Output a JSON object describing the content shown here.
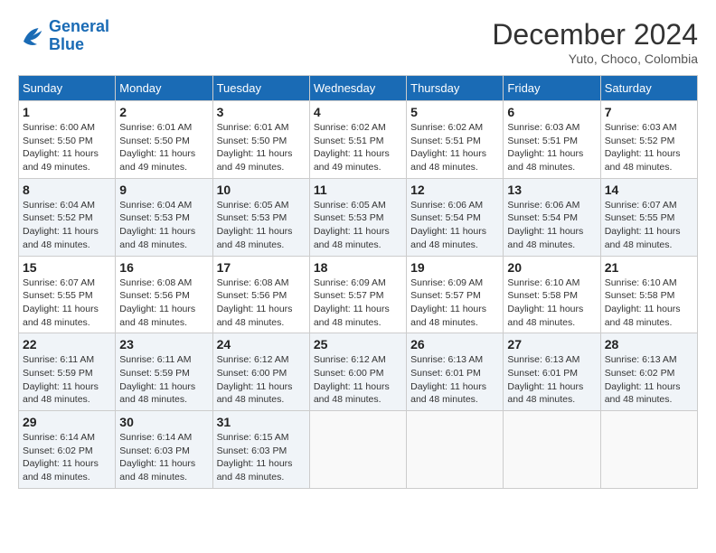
{
  "header": {
    "logo_general": "General",
    "logo_blue": "Blue",
    "month_title": "December 2024",
    "location": "Yuto, Choco, Colombia"
  },
  "columns": [
    "Sunday",
    "Monday",
    "Tuesday",
    "Wednesday",
    "Thursday",
    "Friday",
    "Saturday"
  ],
  "weeks": [
    [
      {
        "day": "1",
        "sunrise": "6:00 AM",
        "sunset": "5:50 PM",
        "daylight": "11 hours and 49 minutes."
      },
      {
        "day": "2",
        "sunrise": "6:01 AM",
        "sunset": "5:50 PM",
        "daylight": "11 hours and 49 minutes."
      },
      {
        "day": "3",
        "sunrise": "6:01 AM",
        "sunset": "5:50 PM",
        "daylight": "11 hours and 49 minutes."
      },
      {
        "day": "4",
        "sunrise": "6:02 AM",
        "sunset": "5:51 PM",
        "daylight": "11 hours and 49 minutes."
      },
      {
        "day": "5",
        "sunrise": "6:02 AM",
        "sunset": "5:51 PM",
        "daylight": "11 hours and 48 minutes."
      },
      {
        "day": "6",
        "sunrise": "6:03 AM",
        "sunset": "5:51 PM",
        "daylight": "11 hours and 48 minutes."
      },
      {
        "day": "7",
        "sunrise": "6:03 AM",
        "sunset": "5:52 PM",
        "daylight": "11 hours and 48 minutes."
      }
    ],
    [
      {
        "day": "8",
        "sunrise": "6:04 AM",
        "sunset": "5:52 PM",
        "daylight": "11 hours and 48 minutes."
      },
      {
        "day": "9",
        "sunrise": "6:04 AM",
        "sunset": "5:53 PM",
        "daylight": "11 hours and 48 minutes."
      },
      {
        "day": "10",
        "sunrise": "6:05 AM",
        "sunset": "5:53 PM",
        "daylight": "11 hours and 48 minutes."
      },
      {
        "day": "11",
        "sunrise": "6:05 AM",
        "sunset": "5:53 PM",
        "daylight": "11 hours and 48 minutes."
      },
      {
        "day": "12",
        "sunrise": "6:06 AM",
        "sunset": "5:54 PM",
        "daylight": "11 hours and 48 minutes."
      },
      {
        "day": "13",
        "sunrise": "6:06 AM",
        "sunset": "5:54 PM",
        "daylight": "11 hours and 48 minutes."
      },
      {
        "day": "14",
        "sunrise": "6:07 AM",
        "sunset": "5:55 PM",
        "daylight": "11 hours and 48 minutes."
      }
    ],
    [
      {
        "day": "15",
        "sunrise": "6:07 AM",
        "sunset": "5:55 PM",
        "daylight": "11 hours and 48 minutes."
      },
      {
        "day": "16",
        "sunrise": "6:08 AM",
        "sunset": "5:56 PM",
        "daylight": "11 hours and 48 minutes."
      },
      {
        "day": "17",
        "sunrise": "6:08 AM",
        "sunset": "5:56 PM",
        "daylight": "11 hours and 48 minutes."
      },
      {
        "day": "18",
        "sunrise": "6:09 AM",
        "sunset": "5:57 PM",
        "daylight": "11 hours and 48 minutes."
      },
      {
        "day": "19",
        "sunrise": "6:09 AM",
        "sunset": "5:57 PM",
        "daylight": "11 hours and 48 minutes."
      },
      {
        "day": "20",
        "sunrise": "6:10 AM",
        "sunset": "5:58 PM",
        "daylight": "11 hours and 48 minutes."
      },
      {
        "day": "21",
        "sunrise": "6:10 AM",
        "sunset": "5:58 PM",
        "daylight": "11 hours and 48 minutes."
      }
    ],
    [
      {
        "day": "22",
        "sunrise": "6:11 AM",
        "sunset": "5:59 PM",
        "daylight": "11 hours and 48 minutes."
      },
      {
        "day": "23",
        "sunrise": "6:11 AM",
        "sunset": "5:59 PM",
        "daylight": "11 hours and 48 minutes."
      },
      {
        "day": "24",
        "sunrise": "6:12 AM",
        "sunset": "6:00 PM",
        "daylight": "11 hours and 48 minutes."
      },
      {
        "day": "25",
        "sunrise": "6:12 AM",
        "sunset": "6:00 PM",
        "daylight": "11 hours and 48 minutes."
      },
      {
        "day": "26",
        "sunrise": "6:13 AM",
        "sunset": "6:01 PM",
        "daylight": "11 hours and 48 minutes."
      },
      {
        "day": "27",
        "sunrise": "6:13 AM",
        "sunset": "6:01 PM",
        "daylight": "11 hours and 48 minutes."
      },
      {
        "day": "28",
        "sunrise": "6:13 AM",
        "sunset": "6:02 PM",
        "daylight": "11 hours and 48 minutes."
      }
    ],
    [
      {
        "day": "29",
        "sunrise": "6:14 AM",
        "sunset": "6:02 PM",
        "daylight": "11 hours and 48 minutes."
      },
      {
        "day": "30",
        "sunrise": "6:14 AM",
        "sunset": "6:03 PM",
        "daylight": "11 hours and 48 minutes."
      },
      {
        "day": "31",
        "sunrise": "6:15 AM",
        "sunset": "6:03 PM",
        "daylight": "11 hours and 48 minutes."
      },
      null,
      null,
      null,
      null
    ]
  ]
}
